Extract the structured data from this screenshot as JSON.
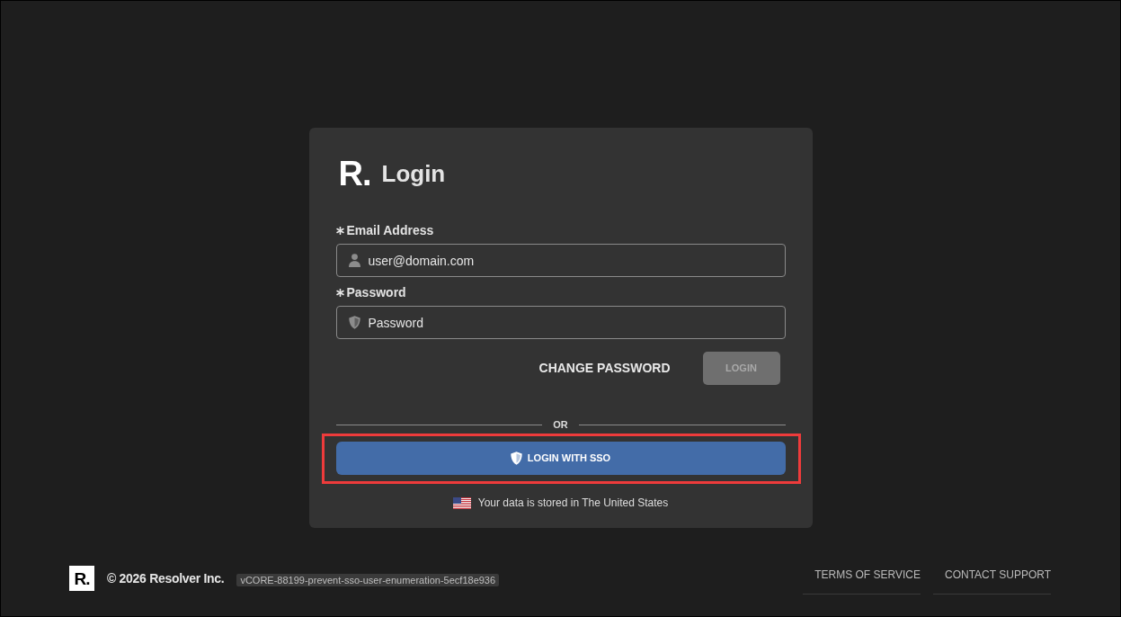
{
  "card": {
    "logo": "R.",
    "title": "Login",
    "fields": [
      {
        "kind": "email",
        "label": "Email Address",
        "required": true,
        "placeholder": "user@domain.com"
      },
      {
        "kind": "password",
        "label": "Password",
        "required": true,
        "placeholder": "Password"
      }
    ],
    "actions": [
      {
        "kind": "text",
        "label": "CHANGE PASSWORD",
        "disabled": false
      },
      {
        "kind": "filled",
        "label": "LOGIN",
        "disabled": true
      }
    ],
    "separator": "OR",
    "sso_button": {
      "label": "LOGIN WITH SSO",
      "highlighted": true
    },
    "data_residency": "Your data is stored in The United States"
  },
  "footer": {
    "logo": "R.",
    "copyright": "© 2026 Resolver Inc.",
    "version": "vCORE-88199-prevent-sso-user-enumeration-5ecf18e936",
    "links": [
      "TERMS OF SERVICE",
      "CONTACT SUPPORT"
    ]
  }
}
